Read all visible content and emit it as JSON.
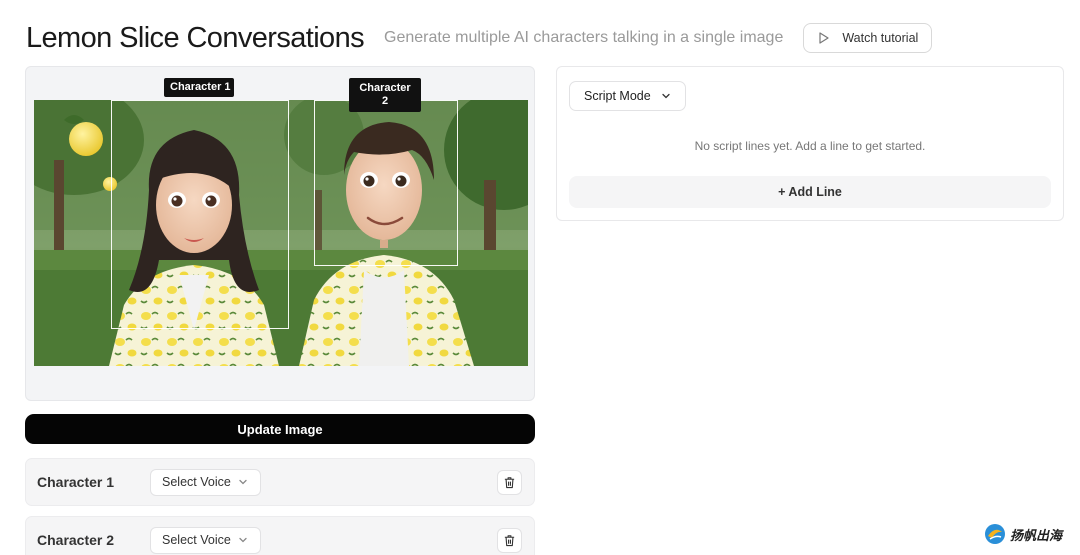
{
  "header": {
    "title": "Lemon Slice Conversations",
    "subtitle": "Generate multiple AI characters talking in a single image",
    "tutorial_label": "Watch tutorial"
  },
  "image_panel": {
    "characters": [
      {
        "tag": "Character 1"
      },
      {
        "tag": "Character 2"
      }
    ]
  },
  "update_button_label": "Update Image",
  "character_rows": [
    {
      "name": "Character 1",
      "voice_placeholder": "Select Voice"
    },
    {
      "name": "Character 2",
      "voice_placeholder": "Select Voice"
    }
  ],
  "script_panel": {
    "mode_label": "Script Mode",
    "empty_message": "No script lines yet. Add a line to get started.",
    "add_line_label": "+ Add Line"
  },
  "watermark": {
    "text": "扬帆出海"
  },
  "colors": {
    "primary_button": "#050505",
    "panel_bg": "#f3f4f6",
    "row_bg": "#f5f5f6",
    "subtitle": "#9a9a9a"
  }
}
